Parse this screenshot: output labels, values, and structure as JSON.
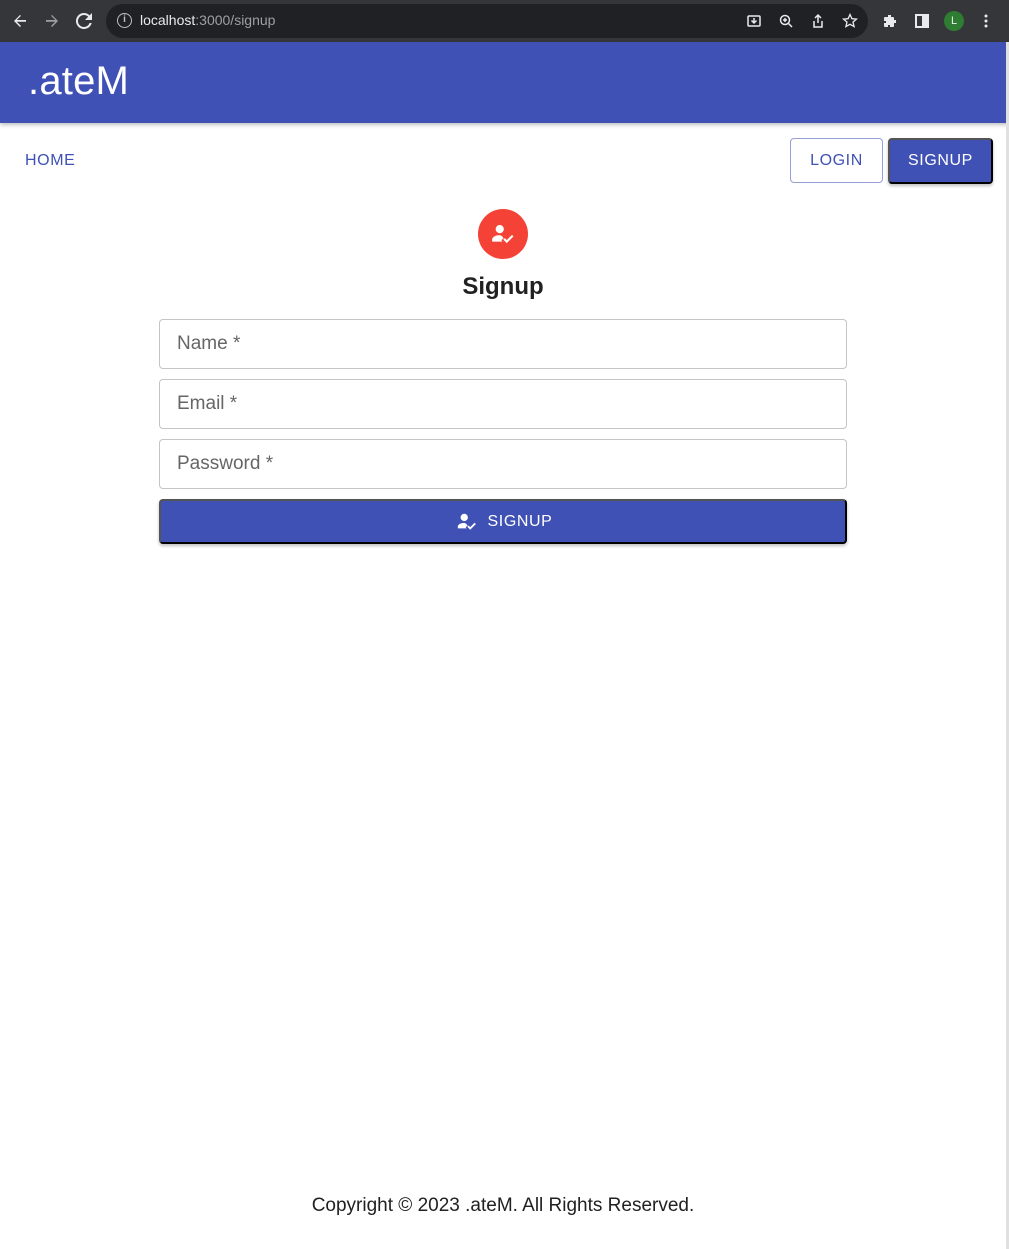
{
  "browser": {
    "url_host": "localhost",
    "url_path": ":3000/signup",
    "profile_initial": "L"
  },
  "app": {
    "title": ".ateM"
  },
  "nav": {
    "home_label": "HOME",
    "login_label": "LOGIN",
    "signup_label": "SIGNUP"
  },
  "form": {
    "title": "Signup",
    "name_placeholder": "Name *",
    "email_placeholder": "Email *",
    "password_placeholder": "Password *",
    "submit_label": "SIGNUP"
  },
  "footer": {
    "text": "Copyright © 2023 .ateM. All Rights Reserved."
  },
  "colors": {
    "primary": "#3f51b5",
    "avatar": "#f44336"
  }
}
